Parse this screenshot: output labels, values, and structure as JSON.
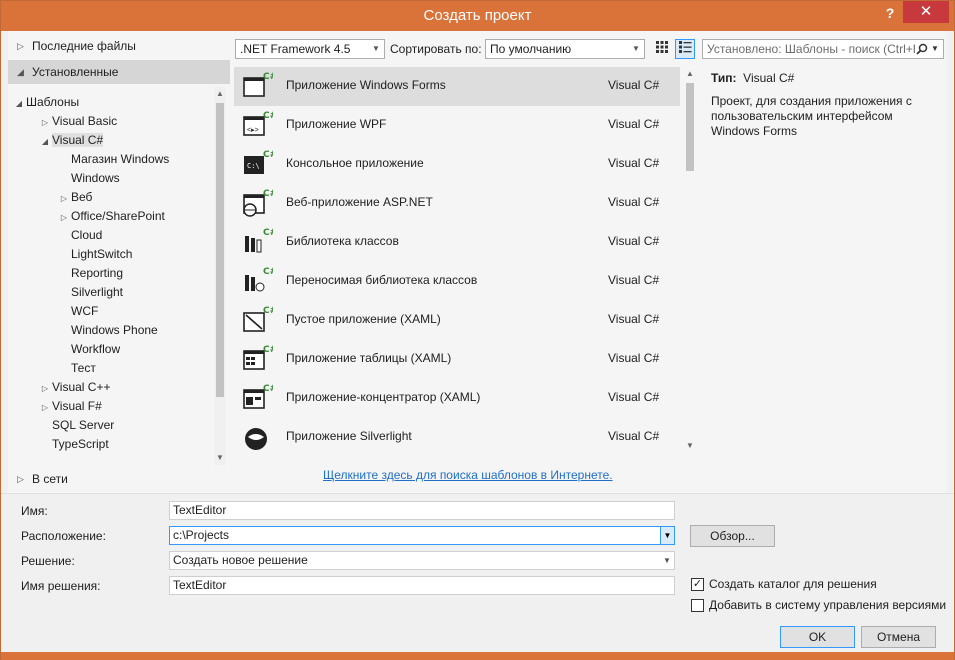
{
  "window": {
    "title": "Создать проект",
    "help_label": "?",
    "close_label": "✕"
  },
  "left": {
    "recent_label": "Последние файлы",
    "installed_label": "Установленные",
    "online_label": "В сети",
    "tree": [
      {
        "label": "Шаблоны",
        "arrow": "◢",
        "level": 0
      },
      {
        "label": "Visual Basic",
        "arrow": "▷",
        "level": 1
      },
      {
        "label": "Visual C#",
        "arrow": "◢",
        "level": 1,
        "selected": true
      },
      {
        "label": "Магазин Windows",
        "arrow": "",
        "level": 2
      },
      {
        "label": "Windows",
        "arrow": "",
        "level": 2
      },
      {
        "label": "Веб",
        "arrow": "▷",
        "level": 2
      },
      {
        "label": "Office/SharePoint",
        "arrow": "▷",
        "level": 2
      },
      {
        "label": "Cloud",
        "arrow": "",
        "level": 2
      },
      {
        "label": "LightSwitch",
        "arrow": "",
        "level": 2
      },
      {
        "label": "Reporting",
        "arrow": "",
        "level": 2
      },
      {
        "label": "Silverlight",
        "arrow": "",
        "level": 2
      },
      {
        "label": "WCF",
        "arrow": "",
        "level": 2
      },
      {
        "label": "Windows Phone",
        "arrow": "",
        "level": 2
      },
      {
        "label": "Workflow",
        "arrow": "",
        "level": 2
      },
      {
        "label": "Тест",
        "arrow": "",
        "level": 2
      },
      {
        "label": "Visual C++",
        "arrow": "▷",
        "level": 1
      },
      {
        "label": "Visual F#",
        "arrow": "▷",
        "level": 1
      },
      {
        "label": "SQL Server",
        "arrow": "",
        "level": 1
      },
      {
        "label": "TypeScript",
        "arrow": "",
        "level": 1
      }
    ]
  },
  "toolbar": {
    "framework": ".NET Framework 4.5",
    "sort_label": "Сортировать по:",
    "sort_value": "По умолчанию",
    "search_placeholder": "Установлено: Шаблоны - поиск (Ctrl+E)"
  },
  "templates": [
    {
      "name": "Приложение Windows Forms",
      "lang": "Visual C#",
      "icon": "winforms-icon",
      "selected": true
    },
    {
      "name": "Приложение WPF",
      "lang": "Visual C#",
      "icon": "wpf-icon"
    },
    {
      "name": "Консольное приложение",
      "lang": "Visual C#",
      "icon": "console-icon"
    },
    {
      "name": "Веб-приложение ASP.NET",
      "lang": "Visual C#",
      "icon": "web-icon"
    },
    {
      "name": "Библиотека классов",
      "lang": "Visual C#",
      "icon": "class-library-icon"
    },
    {
      "name": "Переносимая библиотека классов",
      "lang": "Visual C#",
      "icon": "portable-library-icon"
    },
    {
      "name": "Пустое приложение (XAML)",
      "lang": "Visual C#",
      "icon": "blank-app-icon"
    },
    {
      "name": "Приложение таблицы (XAML)",
      "lang": "Visual C#",
      "icon": "grid-app-icon"
    },
    {
      "name": "Приложение-концентратор (XAML)",
      "lang": "Visual C#",
      "icon": "hub-app-icon"
    },
    {
      "name": "Приложение Silverlight",
      "lang": "Visual C#",
      "icon": "silverlight-icon"
    }
  ],
  "online_link": "Щелкните здесь для поиска шаблонов в Интернете.",
  "description": {
    "type_label": "Тип:",
    "type_value": "Visual C#",
    "text": "Проект, для создания приложения с пользовательским интерфейсом Windows Forms"
  },
  "form": {
    "name_label": "Имя:",
    "name_value": "TextEditor",
    "location_label": "Расположение:",
    "location_value": "c:\\Projects",
    "browse_label": "Обзор...",
    "solution_label": "Решение:",
    "solution_value": "Создать новое решение",
    "solution_name_label": "Имя решения:",
    "solution_name_value": "TextEditor",
    "create_dir_label": "Создать каталог для решения",
    "create_dir_checked": true,
    "add_vcs_label": "Добавить в систему управления версиями",
    "add_vcs_checked": false,
    "ok_label": "OK",
    "cancel_label": "Отмена"
  },
  "colors": {
    "accent": "#d9733a",
    "close": "#c7393c",
    "link": "#1e6fc7",
    "csharp_badge": "#388a34"
  }
}
